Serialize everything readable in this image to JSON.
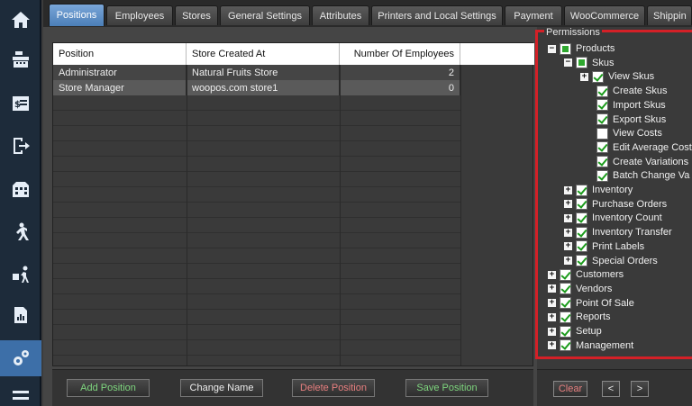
{
  "sidebar": [
    {
      "icon": "home-icon"
    },
    {
      "icon": "cash-register-icon"
    },
    {
      "icon": "invoice-icon"
    },
    {
      "icon": "logout-icon"
    },
    {
      "icon": "building-icon"
    },
    {
      "icon": "walking-person-icon"
    },
    {
      "icon": "delivery-person-icon"
    },
    {
      "icon": "report-icon"
    },
    {
      "icon": "settings-gears-icon"
    },
    {
      "icon": "menu-icon"
    }
  ],
  "tabs": [
    "Positions",
    "Employees",
    "Stores",
    "General Settings",
    "Attributes",
    "Printers and Local Settings",
    "Payment",
    "WooCommerce",
    "Shippin"
  ],
  "grid": {
    "headers": [
      "Position",
      "Store Created At",
      "Number Of Employees"
    ],
    "rows": [
      {
        "position": "Administrator",
        "store": "Natural Fruits Store",
        "count": "2"
      },
      {
        "position": "Store Manager",
        "store": "woopos.com store1",
        "count": "0"
      }
    ]
  },
  "buttons": {
    "add_position": "Add Position",
    "change_name": "Change Name",
    "delete_position": "Delete Position",
    "save_position": "Save Position",
    "clear": "Clear",
    "prev": "<",
    "next": ">"
  },
  "permissions": {
    "legend": "Permissions",
    "tree": [
      {
        "label": "Products",
        "level": 0,
        "expander": "minus",
        "state": "partial"
      },
      {
        "label": "Skus",
        "level": 1,
        "expander": "minus",
        "state": "partial"
      },
      {
        "label": "View Skus",
        "level": 2,
        "expander": "plus",
        "state": "checked"
      },
      {
        "label": "Create Skus",
        "level": 3,
        "expander": "",
        "state": "checked"
      },
      {
        "label": "Import Skus",
        "level": 3,
        "expander": "",
        "state": "checked"
      },
      {
        "label": "Export Skus",
        "level": 3,
        "expander": "",
        "state": "checked"
      },
      {
        "label": "View Costs",
        "level": 3,
        "expander": "",
        "state": "unchecked"
      },
      {
        "label": "Edit Average Cost",
        "level": 3,
        "expander": "",
        "state": "checked"
      },
      {
        "label": "Create Variations",
        "level": 3,
        "expander": "",
        "state": "checked"
      },
      {
        "label": "Batch Change Va",
        "level": 3,
        "expander": "",
        "state": "checked"
      },
      {
        "label": "Inventory",
        "level": 1,
        "expander": "plus",
        "state": "checked"
      },
      {
        "label": "Purchase Orders",
        "level": 1,
        "expander": "plus",
        "state": "checked"
      },
      {
        "label": "Inventory Count",
        "level": 1,
        "expander": "plus",
        "state": "checked"
      },
      {
        "label": "Inventory Transfer",
        "level": 1,
        "expander": "plus",
        "state": "checked"
      },
      {
        "label": "Print Labels",
        "level": 1,
        "expander": "plus",
        "state": "checked"
      },
      {
        "label": "Special Orders",
        "level": 1,
        "expander": "plus",
        "state": "checked"
      },
      {
        "label": "Customers",
        "level": 0,
        "expander": "plus",
        "state": "checked"
      },
      {
        "label": "Vendors",
        "level": 0,
        "expander": "plus",
        "state": "checked"
      },
      {
        "label": "Point Of Sale",
        "level": 0,
        "expander": "plus",
        "state": "checked"
      },
      {
        "label": "Reports",
        "level": 0,
        "expander": "plus",
        "state": "checked"
      },
      {
        "label": "Setup",
        "level": 0,
        "expander": "plus",
        "state": "checked"
      },
      {
        "label": "Management",
        "level": 0,
        "expander": "plus",
        "state": "checked"
      }
    ]
  },
  "colors": {
    "highlight_border": "#d42027",
    "active_tab": "#4b7fb8",
    "sidebar_bg": "#1d2b3a",
    "add_label": "#7fd67f",
    "delete_label": "#e88080"
  }
}
